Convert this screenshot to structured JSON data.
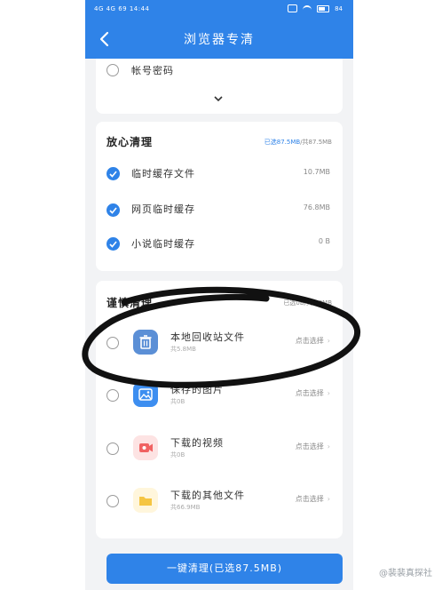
{
  "status_bar": {
    "left": "4G  4G  69  14:44",
    "battery": "84"
  },
  "header": {
    "title": "浏览器专清"
  },
  "account_card": {
    "item_label": "帐号密码"
  },
  "safe_section": {
    "title": "放心清理",
    "summary_selected": "已选87.5MB",
    "summary_total": "/共87.5MB",
    "items": [
      {
        "label": "临时缓存文件",
        "size": "10.7MB"
      },
      {
        "label": "网页临时缓存",
        "size": "76.8MB"
      },
      {
        "label": "小说临时缓存",
        "size": "0 B"
      }
    ]
  },
  "careful_section": {
    "title": "谨慎清理",
    "summary": "已选0B/共5.8MB",
    "items": [
      {
        "label": "本地回收站文件",
        "sub": "共5.8MB",
        "action": "点击选择",
        "icon": "trash-icon"
      },
      {
        "label": "保存的图片",
        "sub": "共0B",
        "action": "点击选择",
        "icon": "image-icon"
      },
      {
        "label": "下载的视频",
        "sub": "共0B",
        "action": "点击选择",
        "icon": "video-icon"
      },
      {
        "label": "下载的其他文件",
        "sub": "共66.9MB",
        "action": "点击选择",
        "icon": "folder-icon"
      }
    ]
  },
  "footer": {
    "button_label": "一键清理(已选87.5MB)"
  },
  "watermark": "@裴裴真探社",
  "colors": {
    "accent": "#2f83e8",
    "trash": "#5b8fd6",
    "image": "#3d8ef0",
    "video": "#f06262",
    "folder": "#f5c542"
  }
}
